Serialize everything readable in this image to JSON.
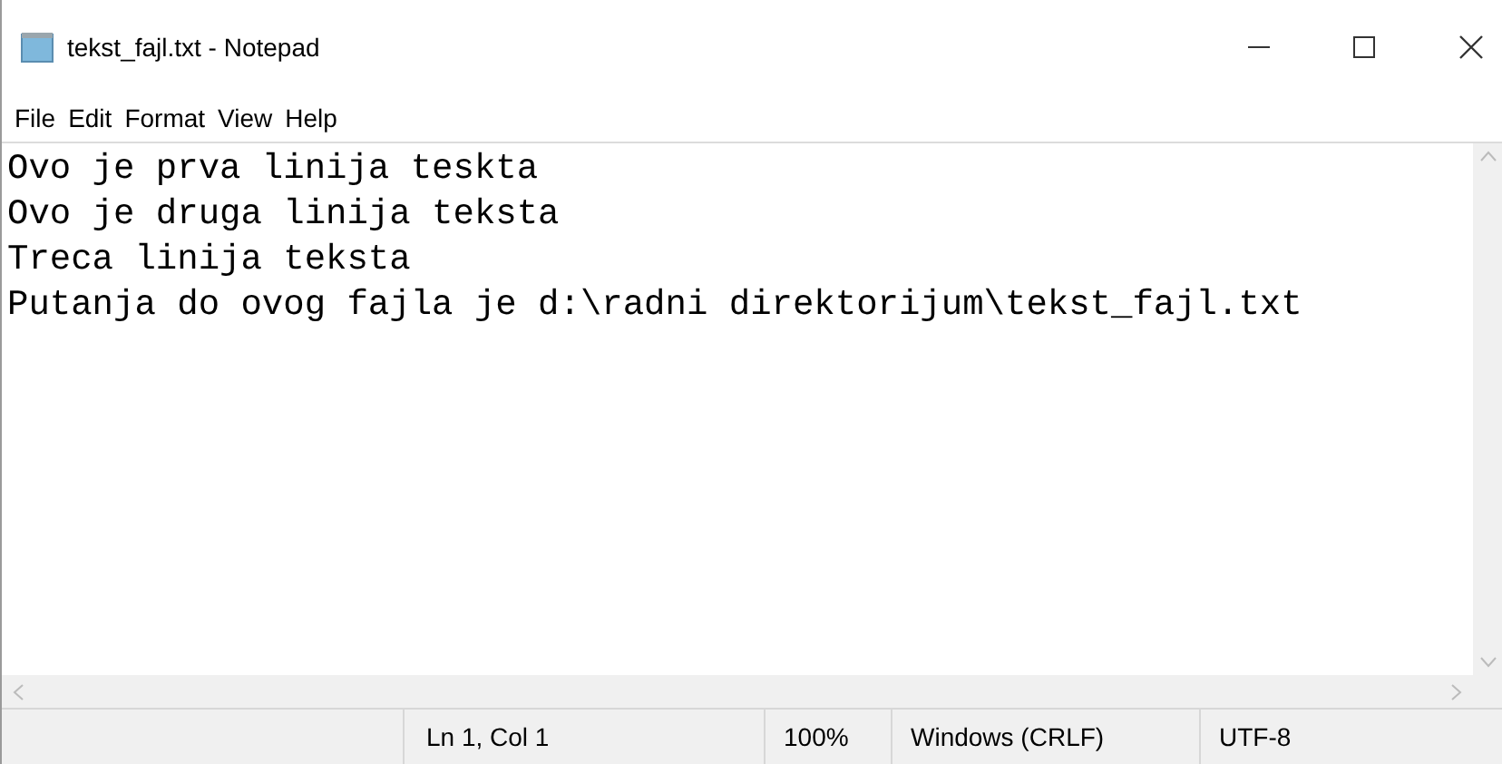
{
  "window": {
    "title": "tekst_fajl.txt - Notepad"
  },
  "menu": [
    "File",
    "Edit",
    "Format",
    "View",
    "Help"
  ],
  "lines": [
    "Ovo je prva linija teskta",
    "Ovo je druga linija teksta",
    "Treca linija teksta",
    "Putanja do ovog fajla je d:\\radni direktorijum\\tekst_fajl.txt"
  ],
  "status_bar": {
    "position": "Ln 1, Col 1",
    "zoom": "100%",
    "line_ending": "Windows (CRLF)",
    "encoding": "UTF-8"
  }
}
